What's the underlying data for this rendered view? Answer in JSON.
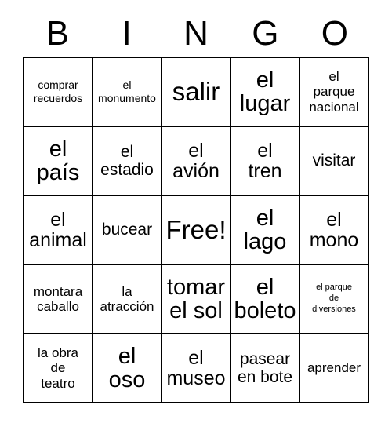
{
  "card": {
    "title_letters": [
      "B",
      "I",
      "N",
      "G",
      "O"
    ],
    "free_space_label": "Free!",
    "rows": [
      [
        {
          "text": "comprar\nrecuerdos",
          "size": "sm"
        },
        {
          "text": "el\nmonumento",
          "size": "sm"
        },
        {
          "text": "salir",
          "size": "hero"
        },
        {
          "text": "el\nlugar",
          "size": "xxl"
        },
        {
          "text": "el\nparque\nnacional",
          "size": "md"
        }
      ],
      [
        {
          "text": "el\npaís",
          "size": "xxl"
        },
        {
          "text": "el\nestadio",
          "size": "lg"
        },
        {
          "text": "el\navión",
          "size": "xl"
        },
        {
          "text": "el\ntren",
          "size": "xl"
        },
        {
          "text": "visitar",
          "size": "lg"
        }
      ],
      [
        {
          "text": "el\nanimal",
          "size": "xl"
        },
        {
          "text": "bucear",
          "size": "lg"
        },
        {
          "text": "Free!",
          "size": "hero"
        },
        {
          "text": "el\nlago",
          "size": "xxl"
        },
        {
          "text": "el\nmono",
          "size": "xl"
        }
      ],
      [
        {
          "text": "montara\ncaballo",
          "size": "md"
        },
        {
          "text": "la\natracción",
          "size": "md"
        },
        {
          "text": "tomar\nel sol",
          "size": "xxl"
        },
        {
          "text": "el\nboleto",
          "size": "xxl"
        },
        {
          "text": "el parque\nde\ndiversiones",
          "size": "xs"
        }
      ],
      [
        {
          "text": "la obra\nde\nteatro",
          "size": "md"
        },
        {
          "text": "el\noso",
          "size": "xxl"
        },
        {
          "text": "el\nmuseo",
          "size": "xl"
        },
        {
          "text": "pasear\nen bote",
          "size": "lg"
        },
        {
          "text": "aprender",
          "size": "md"
        }
      ]
    ]
  }
}
